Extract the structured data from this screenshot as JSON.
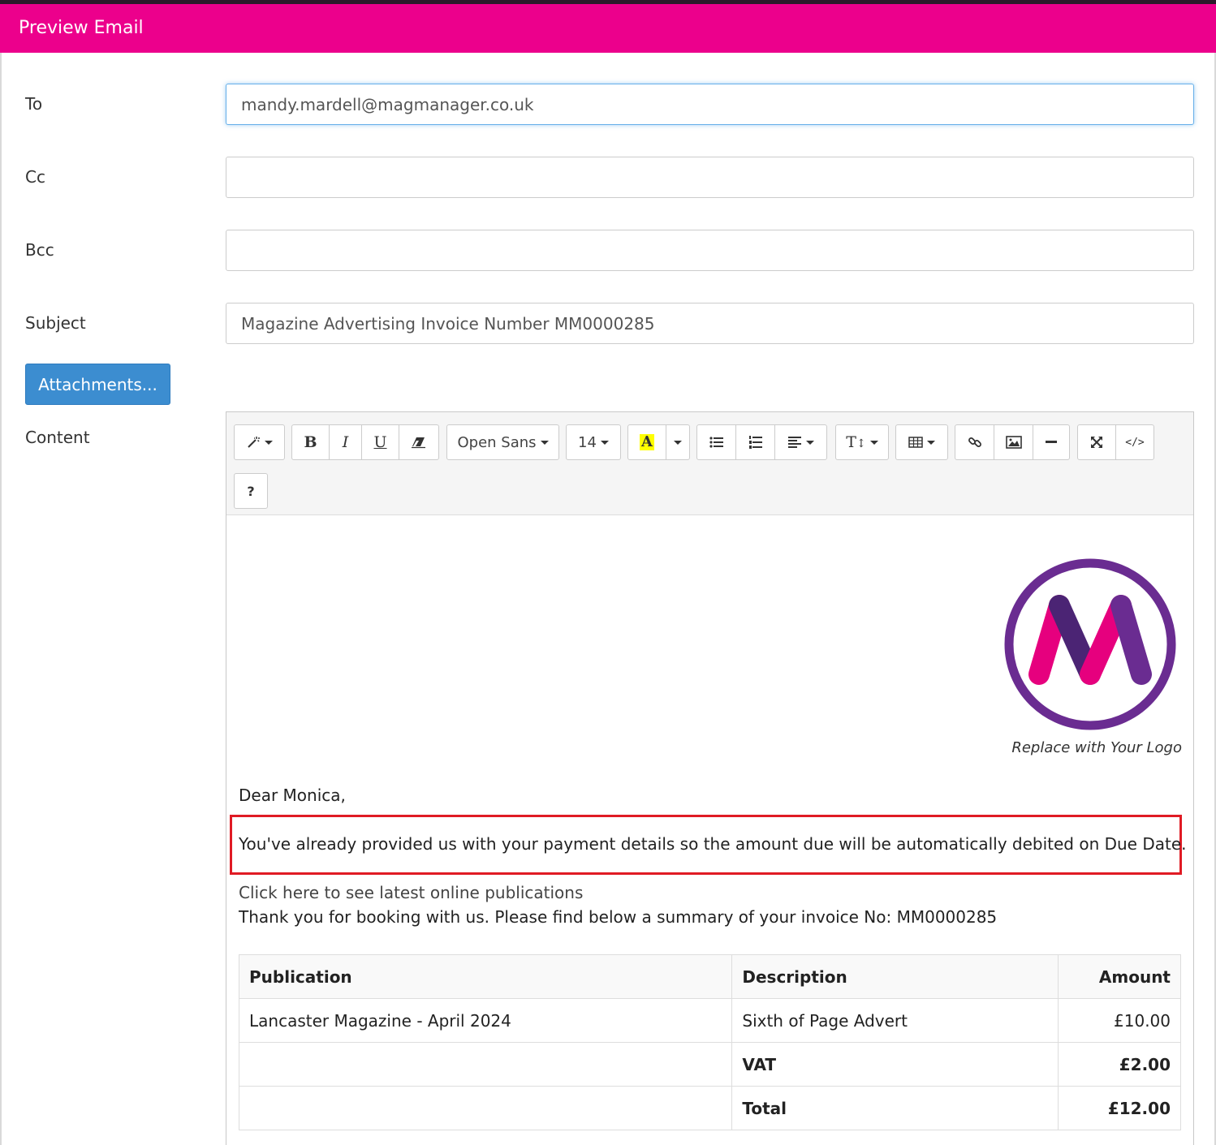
{
  "dialog": {
    "title": "Preview Email"
  },
  "form": {
    "to_label": "To",
    "to_value": "mandy.mardell@magmanager.co.uk",
    "cc_label": "Cc",
    "cc_value": "",
    "bcc_label": "Bcc",
    "bcc_value": "",
    "subject_label": "Subject",
    "subject_value": "Magazine Advertising Invoice Number MM0000285",
    "attachments_label": "Attachments...",
    "content_label": "Content"
  },
  "toolbar": {
    "bold": "B",
    "italic": "I",
    "underline": "U",
    "font_name": "Open Sans",
    "font_size": "14",
    "color_letter": "A",
    "highlight_color": "#ffff00",
    "height_glyph": "T",
    "help": "?",
    "icons": [
      "magic-icon",
      "bold-icon",
      "italic-icon",
      "underline-icon",
      "eraser-icon",
      "font-color-icon",
      "unordered-list-icon",
      "ordered-list-icon",
      "align-icon",
      "line-height-icon",
      "table-icon",
      "link-icon",
      "picture-icon",
      "horizontal-rule-icon",
      "fullscreen-icon",
      "code-view-icon",
      "help-icon"
    ]
  },
  "email": {
    "logo_caption": "Replace with Your Logo",
    "greeting": "Dear Monica,",
    "payment_note": "You've already provided us with your payment details so the amount due will be automatically debited on Due Date.",
    "link_text": "Click here to see latest online publications",
    "summary_text": "Thank you for booking with us. Please find below a summary of your invoice No:  MM0000285",
    "highlight_border_color": "#e01b24",
    "brand_colors": {
      "pink": "#ec008c",
      "purple": "#6a2c91"
    }
  },
  "invoice": {
    "headers": [
      "Publication",
      "Description",
      "Amount"
    ],
    "rows": [
      {
        "publication": "Lancaster Magazine - April 2024",
        "description": "Sixth of Page Advert",
        "amount": "£10.00"
      },
      {
        "publication": "",
        "description": "VAT",
        "amount": "£2.00"
      },
      {
        "publication": "",
        "description": "Total",
        "amount": "£12.00"
      }
    ]
  }
}
